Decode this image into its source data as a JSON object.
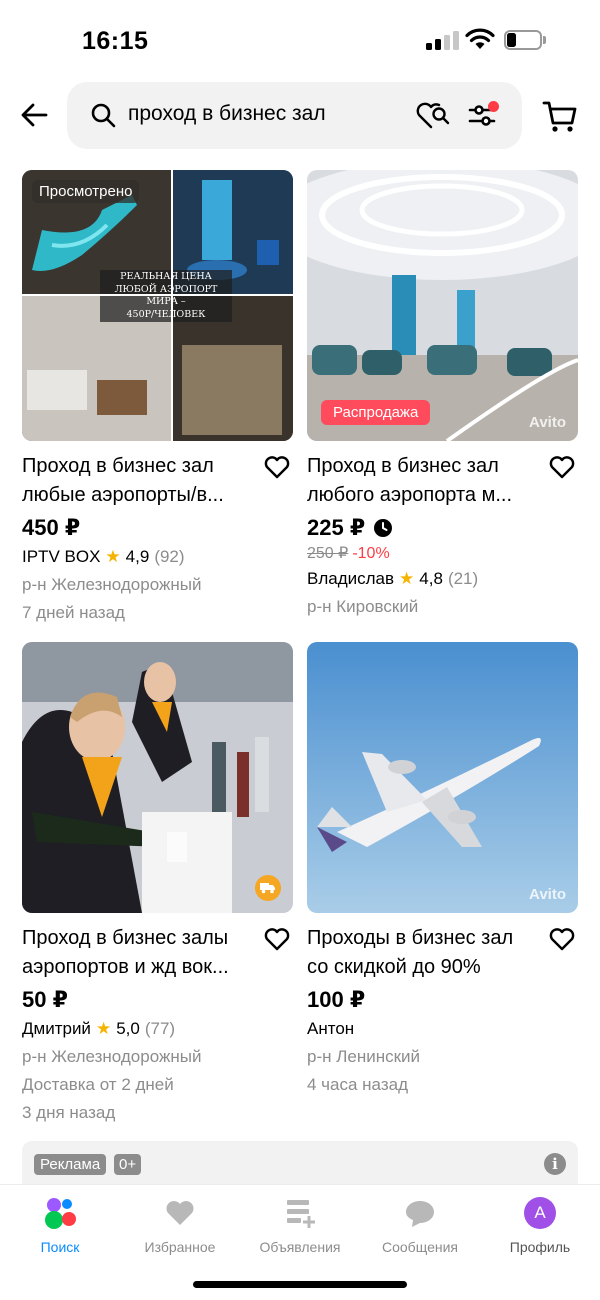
{
  "status_bar": {
    "time": "16:15"
  },
  "search": {
    "query": "проход в бизнес зал"
  },
  "listings": [
    {
      "title_lines": [
        "Проход в бизнес зал",
        "любые аэропорты/в..."
      ],
      "price": "450 ₽",
      "seller": "IPTV BOX",
      "rating": "4,9",
      "reviews": "(92)",
      "district": "р-н Железнодорожный",
      "posted": "7 дней назад",
      "badge": "Просмотрено",
      "image_caption_lines": [
        "РЕАЛЬНАЯ ЦЕНА",
        "ЛЮБОЙ АЭРОПОРТ",
        "МИРА –",
        "450Р/ЧЕЛОВЕК"
      ]
    },
    {
      "title_lines": [
        "Проход в бизнес зал",
        "любого аэропорта м..."
      ],
      "price": "225 ₽",
      "old_price": "250 ₽",
      "discount": "-10%",
      "seller": "Владислав",
      "rating": "4,8",
      "reviews": "(21)",
      "district": "р-н Кировский",
      "badge": "Распродажа",
      "watermark": "Avito"
    },
    {
      "title_lines": [
        "Проход в бизнес залы",
        "аэропортов и жд вок..."
      ],
      "price": "50 ₽",
      "seller": "Дмитрий",
      "rating": "5,0",
      "reviews": "(77)",
      "district": "р-н Железнодорожный",
      "delivery": "Доставка от 2 дней",
      "posted": "3 дня назад"
    },
    {
      "title_lines": [
        "Проходы в бизнес зал",
        "со скидкой до 90%"
      ],
      "price": "100 ₽",
      "seller": "Антон",
      "district": "р-н Ленинский",
      "posted": "4 часа назад",
      "watermark": "Avito"
    }
  ],
  "ad": {
    "label": "Реклама",
    "age": "0+"
  },
  "tabs": [
    {
      "label": "Поиск",
      "icon": "search-dots-icon",
      "active": true
    },
    {
      "label": "Избранное",
      "icon": "heart-icon"
    },
    {
      "label": "Объявления",
      "icon": "listings-icon"
    },
    {
      "label": "Сообщения",
      "icon": "chat-icon"
    },
    {
      "label": "Профиль",
      "icon": "avatar",
      "initial": "A"
    }
  ],
  "colors": {
    "accent": "#0a8bff",
    "sale": "#ff4b5c",
    "discount": "#ff3b44",
    "star": "#f5b400",
    "avatar": "#a050e6"
  }
}
